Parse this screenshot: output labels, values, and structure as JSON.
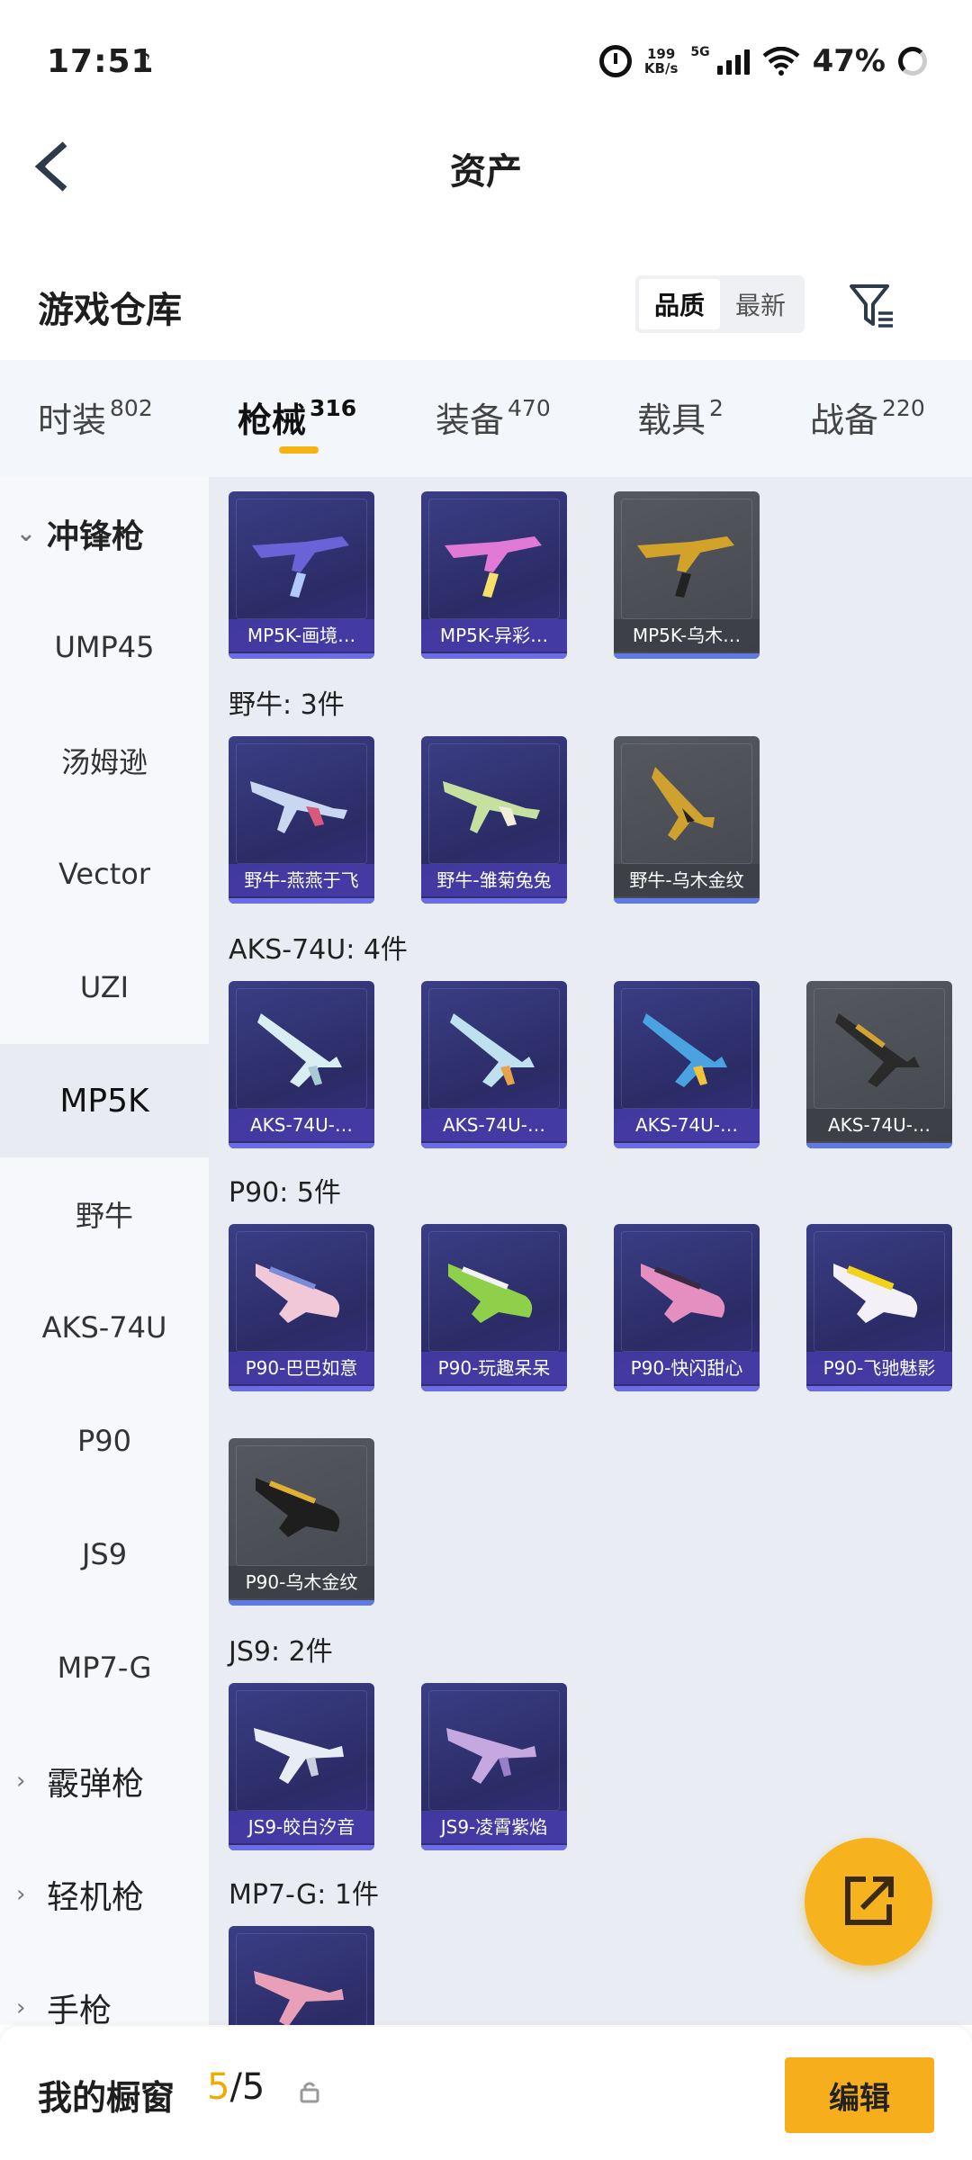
{
  "status": {
    "time": "17:51",
    "speed_value": "199",
    "speed_unit": "KB/s",
    "net": "5G",
    "battery": "47%"
  },
  "header": {
    "title": "资产"
  },
  "section": {
    "title": "游戏仓库",
    "sort_quality": "品质",
    "sort_newest": "最新"
  },
  "tabs": [
    {
      "label": "时装",
      "count": "802"
    },
    {
      "label": "枪械",
      "count": "316"
    },
    {
      "label": "装备",
      "count": "470"
    },
    {
      "label": "载具",
      "count": "2"
    },
    {
      "label": "战备",
      "count": "220"
    }
  ],
  "sidebar": {
    "smg": "冲锋枪",
    "items": [
      "UMP45",
      "汤姆逊",
      "Vector",
      "UZI",
      "MP5K",
      "野牛",
      "AKS-74U",
      "P90",
      "JS9",
      "MP7-G"
    ],
    "shotgun": "霰弹枪",
    "lmg": "轻机枪",
    "pistol": "手枪"
  },
  "groups": {
    "mp5k": [
      "MP5K-画境…",
      "MP5K-异彩…",
      "MP5K-乌木…"
    ],
    "bizon_label": "野牛: 3件",
    "bizon": [
      "野牛-燕燕于飞",
      "野牛-雏菊兔兔",
      "野牛-乌木金纹"
    ],
    "aks_label": "AKS-74U: 4件",
    "aks": [
      "AKS-74U-…",
      "AKS-74U-…",
      "AKS-74U-…",
      "AKS-74U-…"
    ],
    "p90_label": "P90: 5件",
    "p90": [
      "P90-巴巴如意",
      "P90-玩趣呆呆",
      "P90-快闪甜心",
      "P90-飞驰魅影",
      "P90-乌木金纹"
    ],
    "js9_label": "JS9: 2件",
    "js9": [
      "JS9-皎白汐音",
      "JS9-凌霄紫焰"
    ],
    "mp7_label": "MP7-G: 1件"
  },
  "bottom": {
    "title": "我的橱窗",
    "current": "5",
    "total": "/5",
    "edit": "编辑"
  },
  "colors": {
    "accent": "#f6ae1c",
    "card_epic": "#2f3170",
    "card_legend": "#4e5058"
  }
}
